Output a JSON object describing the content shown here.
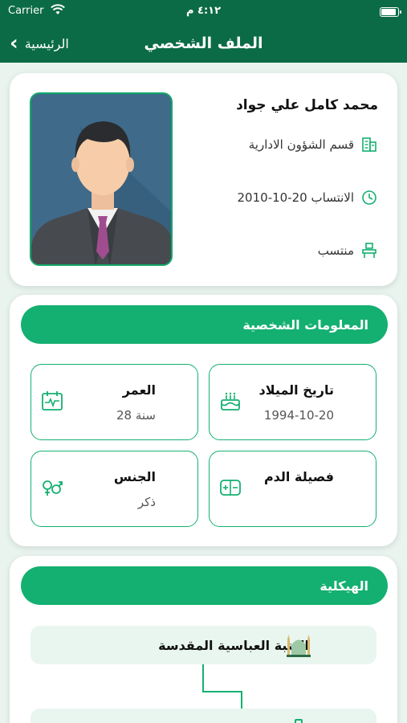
{
  "status_bar": {
    "carrier": "Carrier",
    "time": "٤:١٢ م"
  },
  "nav": {
    "back_label": "الرئيسية",
    "title": "الملف الشخصي"
  },
  "profile": {
    "name": "محمد كامل علي جواد",
    "department": "قسم الشؤون الادارية",
    "assignment_date": "الانتساب 20-10-2010",
    "status": "منتسب",
    "icons": {
      "department": "building-icon",
      "date": "clock-icon",
      "status": "desk-icon"
    }
  },
  "personal_info": {
    "title": "المعلومات الشخصية",
    "tiles": [
      {
        "label": "تاريخ الميلاد",
        "value": "1994-10-20",
        "icon": "birthday-cake-icon"
      },
      {
        "label": "العمر",
        "value": "28 سنة",
        "icon": "calendar-pulse-icon"
      },
      {
        "label": "فصيلة الدم",
        "value": "",
        "icon": "blood-type-icon"
      },
      {
        "label": "الجنس",
        "value": "ذكر",
        "icon": "gender-icon"
      }
    ]
  },
  "structure": {
    "title": "الهيكلية",
    "root": "العتبة العباسية المقدسة"
  },
  "colors": {
    "primary_dark": "#0b6b46",
    "accent": "#14b071",
    "background": "#eaf4ef"
  }
}
